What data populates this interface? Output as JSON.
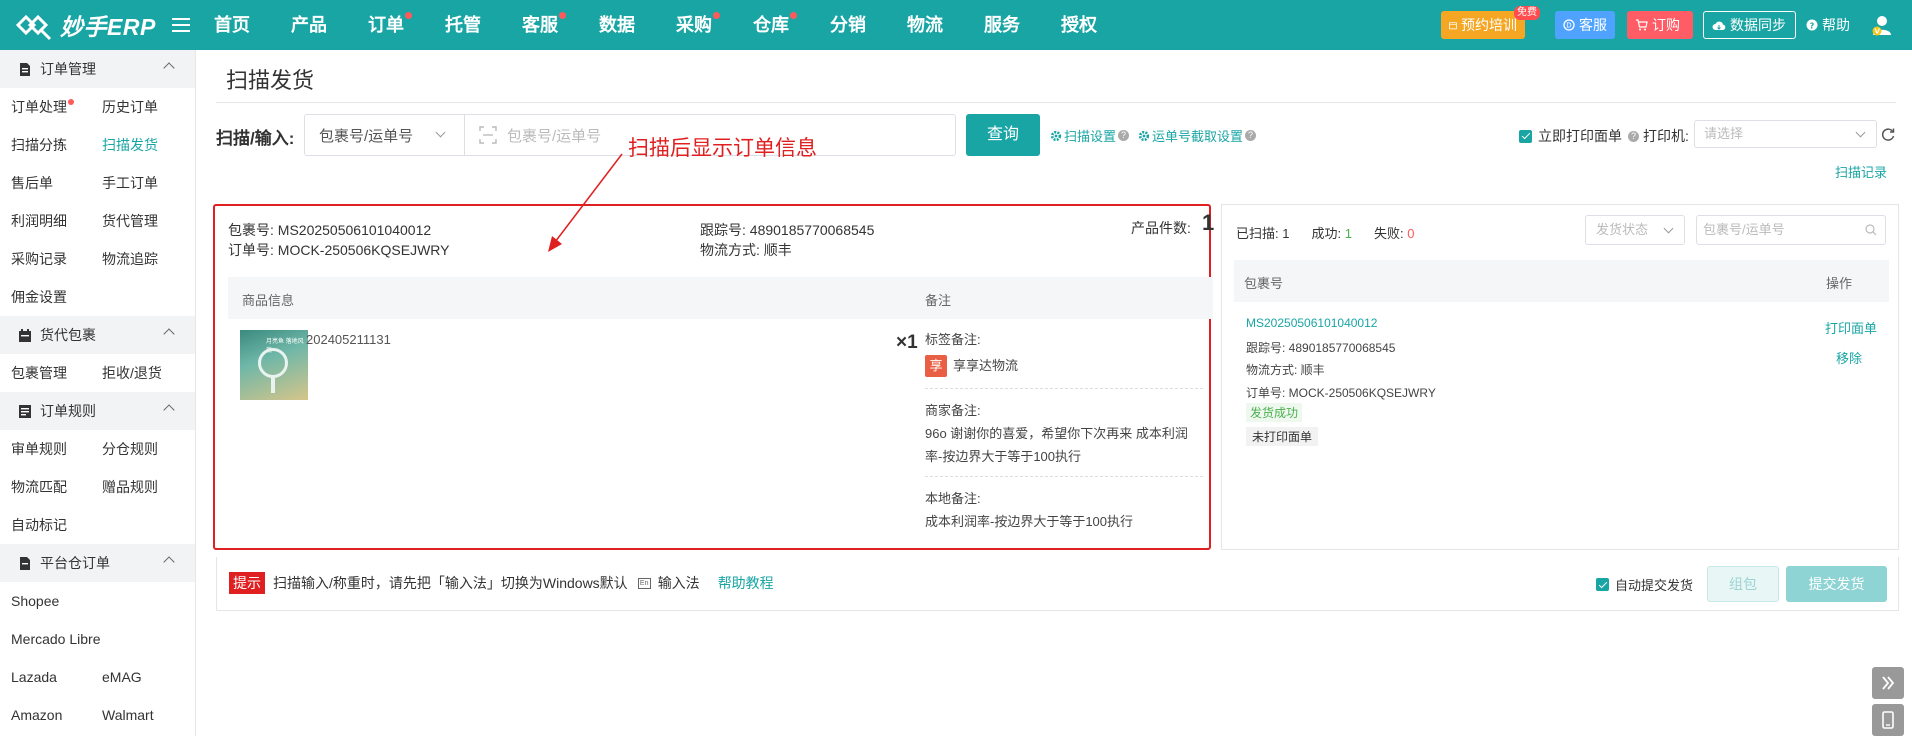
{
  "app": {
    "logo_text": "妙手ERP"
  },
  "nav": [
    {
      "label": "首页",
      "dot": false
    },
    {
      "label": "产品",
      "dot": false
    },
    {
      "label": "订单",
      "dot": true
    },
    {
      "label": "托管",
      "dot": false
    },
    {
      "label": "客服",
      "dot": true
    },
    {
      "label": "数据",
      "dot": false
    },
    {
      "label": "采购",
      "dot": true
    },
    {
      "label": "仓库",
      "dot": true
    },
    {
      "label": "分销",
      "dot": false
    },
    {
      "label": "物流",
      "dot": false
    },
    {
      "label": "服务",
      "dot": false
    },
    {
      "label": "授权",
      "dot": false
    }
  ],
  "top_right": {
    "training": "预约培训",
    "free_tag": "免费",
    "service": "客服",
    "subscribe": "订购",
    "sync": "数据同步",
    "help": "帮助"
  },
  "sidebar": {
    "sections": [
      {
        "title": "订单管理",
        "links": [
          {
            "label": "订单处理",
            "dot": true,
            "active": false
          },
          {
            "label": "历史订单",
            "dot": false,
            "active": false
          },
          {
            "label": "扫描分拣",
            "dot": false,
            "active": false
          },
          {
            "label": "扫描发货",
            "dot": false,
            "active": true
          },
          {
            "label": "售后单",
            "dot": false,
            "active": false
          },
          {
            "label": "手工订单",
            "dot": false,
            "active": false
          },
          {
            "label": "利润明细",
            "dot": false,
            "active": false
          },
          {
            "label": "货代管理",
            "dot": false,
            "active": false
          },
          {
            "label": "采购记录",
            "dot": false,
            "active": false
          },
          {
            "label": "物流追踪",
            "dot": false,
            "active": false
          },
          {
            "label": "佣金设置",
            "dot": false,
            "active": false
          }
        ]
      },
      {
        "title": "货代包裹",
        "links": [
          {
            "label": "包裹管理",
            "dot": false,
            "active": false
          },
          {
            "label": "拒收/退货",
            "dot": false,
            "active": false
          }
        ]
      },
      {
        "title": "订单规则",
        "links": [
          {
            "label": "审单规则",
            "dot": false,
            "active": false
          },
          {
            "label": "分仓规则",
            "dot": false,
            "active": false
          },
          {
            "label": "物流匹配",
            "dot": false,
            "active": false
          },
          {
            "label": "赠品规则",
            "dot": false,
            "active": false
          },
          {
            "label": "自动标记",
            "dot": false,
            "active": false
          }
        ]
      },
      {
        "title": "平台仓订单",
        "links": [
          {
            "label": "Shopee",
            "dot": false,
            "active": false
          },
          {
            "label": "",
            "dot": false,
            "active": false
          },
          {
            "label": "Mercado Libre",
            "dot": false,
            "active": false
          },
          {
            "label": "",
            "dot": false,
            "active": false
          },
          {
            "label": "Lazada",
            "dot": false,
            "active": false
          },
          {
            "label": "eMAG",
            "dot": false,
            "active": false
          },
          {
            "label": "Amazon",
            "dot": false,
            "active": false
          },
          {
            "label": "Walmart",
            "dot": false,
            "active": false
          }
        ]
      }
    ]
  },
  "main": {
    "title": "扫描发货",
    "scan_label": "扫描/输入:",
    "scan_type": "包裹号/运单号",
    "scan_placeholder": "包裹号/运单号",
    "query_button": "查询",
    "scan_settings": "扫描设置",
    "waybill_settings": "运单号截取设置",
    "annotation": "扫描后显示订单信息",
    "print_now": "立即打印面单",
    "printer_label": "打印机:",
    "printer_placeholder": "请选择",
    "scan_record": "扫描记录"
  },
  "order": {
    "package_label": "包裹号:",
    "package_no": "MS20250506101040012",
    "order_label": "订单号:",
    "order_no": "MOCK-250506KQSEJWRY",
    "tracking_label": "跟踪号:",
    "tracking_no": "4890185770068545",
    "logistics_label": "物流方式:",
    "logistics": "顺丰",
    "count_label": "产品件数:",
    "count": "1",
    "col_product": "商品信息",
    "col_remark": "备注",
    "sku": "202405211131",
    "qty": "×1",
    "image_text": "月亮鱼 落地风扇",
    "tag_remark_label": "标签备注:",
    "tag_char": "享",
    "tag_remark": "享享达物流",
    "merchant_remark_label": "商家备注:",
    "merchant_remark_line1": "96o 谢谢你的喜爱，希望你下次再来 成本利润",
    "merchant_remark_line2": "率-按边界大于等于100执行",
    "local_remark_label": "本地备注:",
    "local_remark": "成本利润率-按边界大于等于100执行"
  },
  "scan_panel": {
    "scanned_label": "已扫描:",
    "scanned": "1",
    "success_label": "成功:",
    "success": "1",
    "fail_label": "失败:",
    "fail": "0",
    "status_placeholder": "发货状态",
    "search_placeholder": "包裹号/运单号",
    "col_package": "包裹号",
    "col_action": "操作",
    "row": {
      "package_no": "MS20250506101040012",
      "tracking": "跟踪号:  4890185770068545",
      "logistics": "物流方式:  顺丰",
      "order": "订单号:  MOCK-250506KQSEJWRY",
      "status": "发货成功",
      "print_status": "未打印面单",
      "action_print": "打印面单",
      "action_remove": "移除"
    }
  },
  "bottom": {
    "hint_tag": "提示",
    "hint_text": "扫描输入/称重时，请先把「输入法」切换为Windows默认",
    "ime_label": "输入法",
    "help_link": "帮助教程",
    "auto_submit": "自动提交发货",
    "group_button": "组包",
    "submit_button": "提交发货"
  },
  "colors": {
    "primary": "#1aa5a5",
    "annotation_red": "#e02020"
  }
}
